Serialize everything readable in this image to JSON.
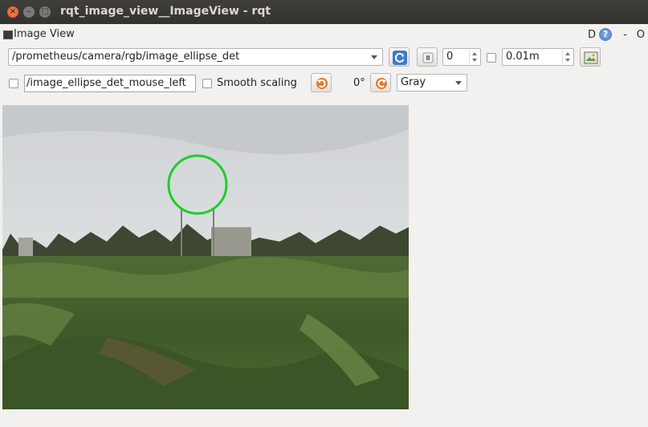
{
  "window": {
    "title": "rqt_image_view__ImageView - rqt",
    "close_glyph": "×",
    "min_glyph": "–",
    "max_glyph": "□"
  },
  "plugin": {
    "title": "Image View",
    "right_d": "D",
    "help_glyph": "?",
    "right_dash": "-",
    "right_o": "O"
  },
  "toolbar": {
    "topic": "/prometheus/camera/rgb/image_ellipse_det",
    "spin_value": "0",
    "rate_value": "0.01m",
    "mouse_topic": "/image_ellipse_det_mouse_left",
    "smooth_label": "Smooth scaling",
    "rotation": "0°",
    "color_scheme": "Gray"
  },
  "icons": {
    "refresh": "refresh-icon",
    "pause": "pause-icon",
    "save": "save-image-icon",
    "rotate_left": "rotate-left-icon",
    "rotate_right": "rotate-right-icon"
  },
  "colors": {
    "titlebar": "#3c3b37",
    "background": "#f2f1f0",
    "detection_circle": "#1fcc2a"
  }
}
